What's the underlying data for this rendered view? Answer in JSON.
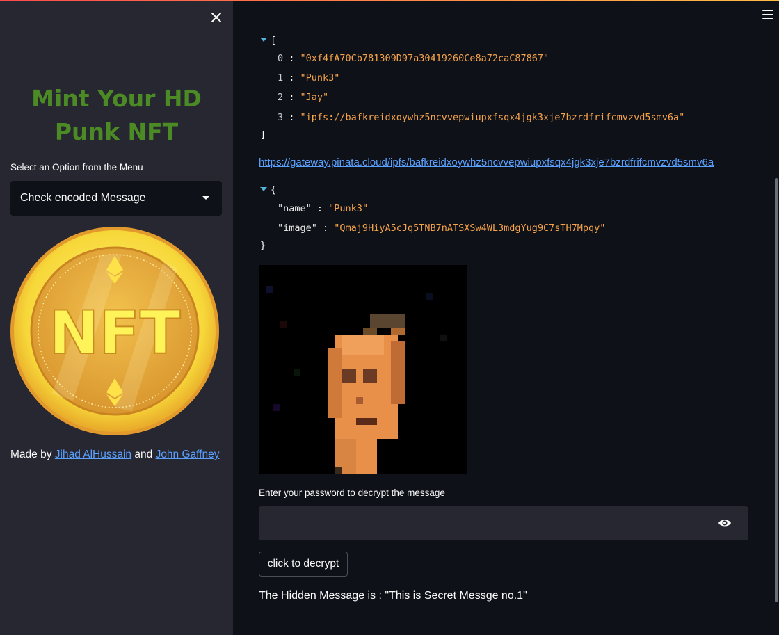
{
  "sidebar": {
    "title_line1": "Mint Your HD",
    "title_line2": "Punk NFT",
    "select_label": "Select an Option from the Menu",
    "select_value": "Check encoded Message",
    "coin_text": "NFT",
    "made_by_prefix": "Made by",
    "author1": "Jihad AlHussain",
    "and_text": "and",
    "author2": "John Gaffney"
  },
  "array_json": {
    "open": "[",
    "close": "]",
    "items": [
      {
        "index": "0",
        "value": "\"0xf4fA70Cb781309D97a30419260Ce8a72caC87867\""
      },
      {
        "index": "1",
        "value": "\"Punk3\""
      },
      {
        "index": "2",
        "value": "\"Jay\""
      },
      {
        "index": "3",
        "value": "\"ipfs://bafkreidxoywhz5ncvvepwiupxfsqx4jgk3xje7bzrdfrifcmvzvd5smv6a\""
      }
    ]
  },
  "gateway_link": "https://gateway.pinata.cloud/ipfs/bafkreidxoywhz5ncvvepwiupxfsqx4jgk3xje7bzrdfrifcmvzvd5smv6a",
  "object_json": {
    "open": "{",
    "close": "}",
    "entries": [
      {
        "key": "\"name\"",
        "value": "\"Punk3\""
      },
      {
        "key": "\"image\"",
        "value": "\"Qmaj9HiyA5cJq5TNB7nATSXSw4WL3mdgYug9C7sTH7Mpqy\""
      }
    ]
  },
  "password": {
    "label": "Enter your password to decrypt the message",
    "value": ""
  },
  "decrypt_button": "click to decrypt",
  "result_text": "The Hidden Message is : \"This is Secret Messge no.1\"",
  "colors": {
    "title_green": "#4b8a24",
    "link_blue": "#5aa0ff",
    "string_orange": "#f6a34a",
    "sidebar_bg": "#262730",
    "main_bg": "#0e1117"
  }
}
